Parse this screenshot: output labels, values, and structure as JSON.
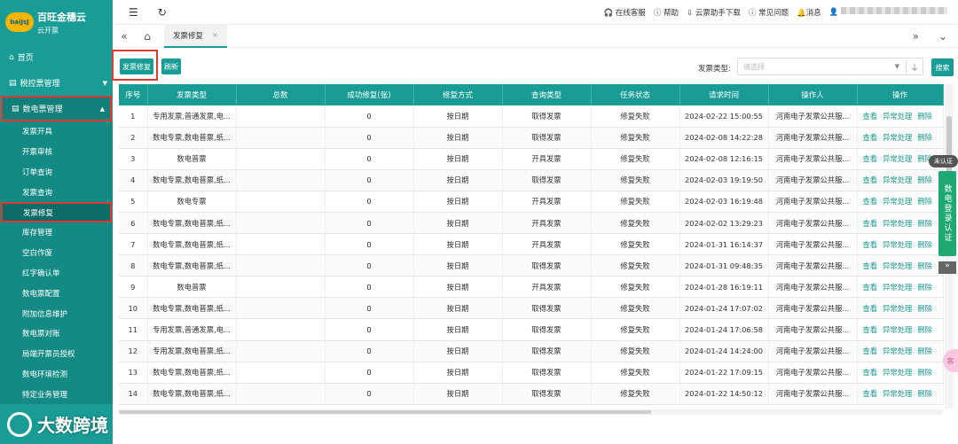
{
  "app": {
    "name": "百旺金穗云",
    "subtitle": "云开票",
    "logo_text": "baiJsJ"
  },
  "sidebar": {
    "main_items": [
      {
        "label": "首页",
        "icon": "home-icon"
      },
      {
        "label": "税控票管理",
        "icon": "list-icon"
      },
      {
        "label": "数电票管理",
        "icon": "list-icon"
      }
    ],
    "sub_items": [
      "发票开具",
      "开票审核",
      "订单查询",
      "发票查询",
      "发票修复",
      "库存管理",
      "空白作废",
      "红字确认单",
      "数电票配置",
      "附加信息维护",
      "数电票对账",
      "局端开票员授权",
      "数电环境检测",
      "特定业务管理"
    ]
  },
  "topbar": {
    "online_service": "在线客服",
    "help": "帮助",
    "download": "云票助手下载",
    "faq": "常见问题",
    "messages": "消息"
  },
  "tabs": {
    "active": "发票修复"
  },
  "toolbar": {
    "repair_button": "发票修复",
    "refresh_button": "刷新",
    "filter_label": "发票类型:",
    "filter_placeholder": "请选择",
    "search_button": "搜索"
  },
  "table": {
    "headers": [
      "序号",
      "发票类型",
      "总数",
      "成功修复(张)",
      "修复方式",
      "查询类型",
      "任务状态",
      "请求时间",
      "操作人",
      "操作"
    ],
    "ops": {
      "view": "查看",
      "error": "异常处理",
      "delete": "删除"
    },
    "rows": [
      [
        "1",
        "专用发票,普通发票,电...",
        "",
        "0",
        "按日期",
        "取得发票",
        "修复失败",
        "2024-02-22 15:00:55",
        "河南电子发票公共服..."
      ],
      [
        "2",
        "数电专票,数电普票,纸...",
        "",
        "0",
        "按日期",
        "取得发票",
        "修复失败",
        "2024-02-08 14:22:28",
        "河南电子发票公共服..."
      ],
      [
        "3",
        "数电普票",
        "",
        "0",
        "按日期",
        "开具发票",
        "修复失败",
        "2024-02-08 12:16:15",
        "河南电子发票公共服..."
      ],
      [
        "4",
        "数电专票,数电普票,纸...",
        "",
        "0",
        "按日期",
        "取得发票",
        "修复失败",
        "2024-02-03 19:19:50",
        "河南电子发票公共服..."
      ],
      [
        "5",
        "数电专票",
        "",
        "0",
        "按日期",
        "开具发票",
        "修复失败",
        "2024-02-03 16:19:48",
        "河南电子发票公共服..."
      ],
      [
        "6",
        "数电专票,数电普票,纸...",
        "",
        "0",
        "按日期",
        "开具发票",
        "修复失败",
        "2024-02-02 13:29:23",
        "河南电子发票公共服..."
      ],
      [
        "7",
        "数电专票,数电普票,纸...",
        "",
        "0",
        "按日期",
        "开具发票",
        "修复失败",
        "2024-01-31 16:14:37",
        "河南电子发票公共服..."
      ],
      [
        "8",
        "数电专票,数电普票,纸...",
        "",
        "0",
        "按日期",
        "取得发票",
        "修复失败",
        "2024-01-31 09:48:35",
        "河南电子发票公共服..."
      ],
      [
        "9",
        "数电普票",
        "",
        "0",
        "按日期",
        "开具发票",
        "修复失败",
        "2024-01-28 16:19:11",
        "河南电子发票公共服..."
      ],
      [
        "10",
        "数电专票,数电普票,纸...",
        "",
        "0",
        "按日期",
        "取得发票",
        "修复失败",
        "2024-01-24 17:07:02",
        "河南电子发票公共服..."
      ],
      [
        "11",
        "专用发票,普通发票,电...",
        "",
        "0",
        "按日期",
        "取得发票",
        "修复失败",
        "2024-01-24 17:06:58",
        "河南电子发票公共服..."
      ],
      [
        "12",
        "专用发票,数电普票,纸...",
        "",
        "0",
        "按日期",
        "取得发票",
        "修复失败",
        "2024-01-24 14:24:00",
        "河南电子发票公共服..."
      ],
      [
        "13",
        "数电专票,数电普票,纸...",
        "",
        "0",
        "按日期",
        "取得发票",
        "修复失败",
        "2024-01-22 17:09:15",
        "河南电子发票公共服..."
      ],
      [
        "14",
        "数电专票,数电普票,纸...",
        "",
        "0",
        "按日期",
        "取得发票",
        "修复失败",
        "2024-01-22 14:50:12",
        "河南电子发票公共服..."
      ]
    ]
  },
  "float_cert": {
    "badge": "未认证",
    "label": "数电登录认证"
  },
  "pink_tab": "客",
  "watermark": "大数跨境",
  "colors": {
    "primary": "#1a9c96",
    "highlight": "#e0392f"
  }
}
